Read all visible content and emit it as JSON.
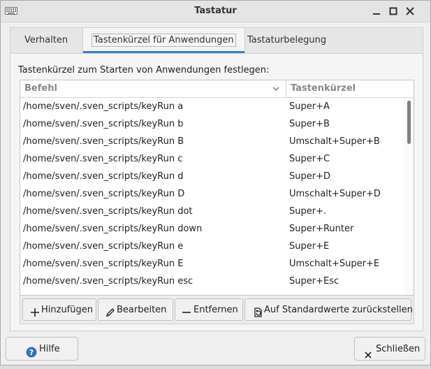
{
  "window": {
    "title": "Tastatur"
  },
  "tabs": [
    {
      "label": "Verhalten"
    },
    {
      "label": "Tastenkürzel für Anwendungen"
    },
    {
      "label": "Tastaturbelegung"
    }
  ],
  "active_tab": 1,
  "shortcuts": {
    "description": "Tastenkürzel zum Starten von Anwendungen festlegen:",
    "columns": {
      "command": "Befehl",
      "shortcut": "Tastenkürzel"
    },
    "rows": [
      {
        "command": "/home/sven/.sven_scripts/keyRun a",
        "shortcut": "Super+A"
      },
      {
        "command": "/home/sven/.sven_scripts/keyRun b",
        "shortcut": "Super+B"
      },
      {
        "command": "/home/sven/.sven_scripts/keyRun B",
        "shortcut": "Umschalt+Super+B"
      },
      {
        "command": "/home/sven/.sven_scripts/keyRun c",
        "shortcut": "Super+C"
      },
      {
        "command": "/home/sven/.sven_scripts/keyRun d",
        "shortcut": "Super+D"
      },
      {
        "command": "/home/sven/.sven_scripts/keyRun D",
        "shortcut": "Umschalt+Super+D"
      },
      {
        "command": "/home/sven/.sven_scripts/keyRun dot",
        "shortcut": "Super+."
      },
      {
        "command": "/home/sven/.sven_scripts/keyRun down",
        "shortcut": "Super+Runter"
      },
      {
        "command": "/home/sven/.sven_scripts/keyRun e",
        "shortcut": "Super+E"
      },
      {
        "command": "/home/sven/.sven_scripts/keyRun E",
        "shortcut": "Umschalt+Super+E"
      },
      {
        "command": "/home/sven/.sven_scripts/keyRun esc",
        "shortcut": "Super+Esc"
      }
    ],
    "buttons": {
      "add": "Hinzufügen",
      "edit": "Bearbeiten",
      "remove": "Entfernen",
      "reset": "Auf Standardwerte zurückstellen"
    }
  },
  "footer": {
    "help": "Hilfe",
    "close": "Schließen"
  },
  "colors": {
    "accent": "#3b80c9",
    "help_icon": "#3a6fb7"
  },
  "icons": [
    "keyboard-icon",
    "chevron-down-icon",
    "minimize-icon",
    "maximize-icon",
    "close-icon",
    "plus-icon",
    "pencil-icon",
    "minus-icon",
    "revert-icon",
    "help-icon"
  ]
}
